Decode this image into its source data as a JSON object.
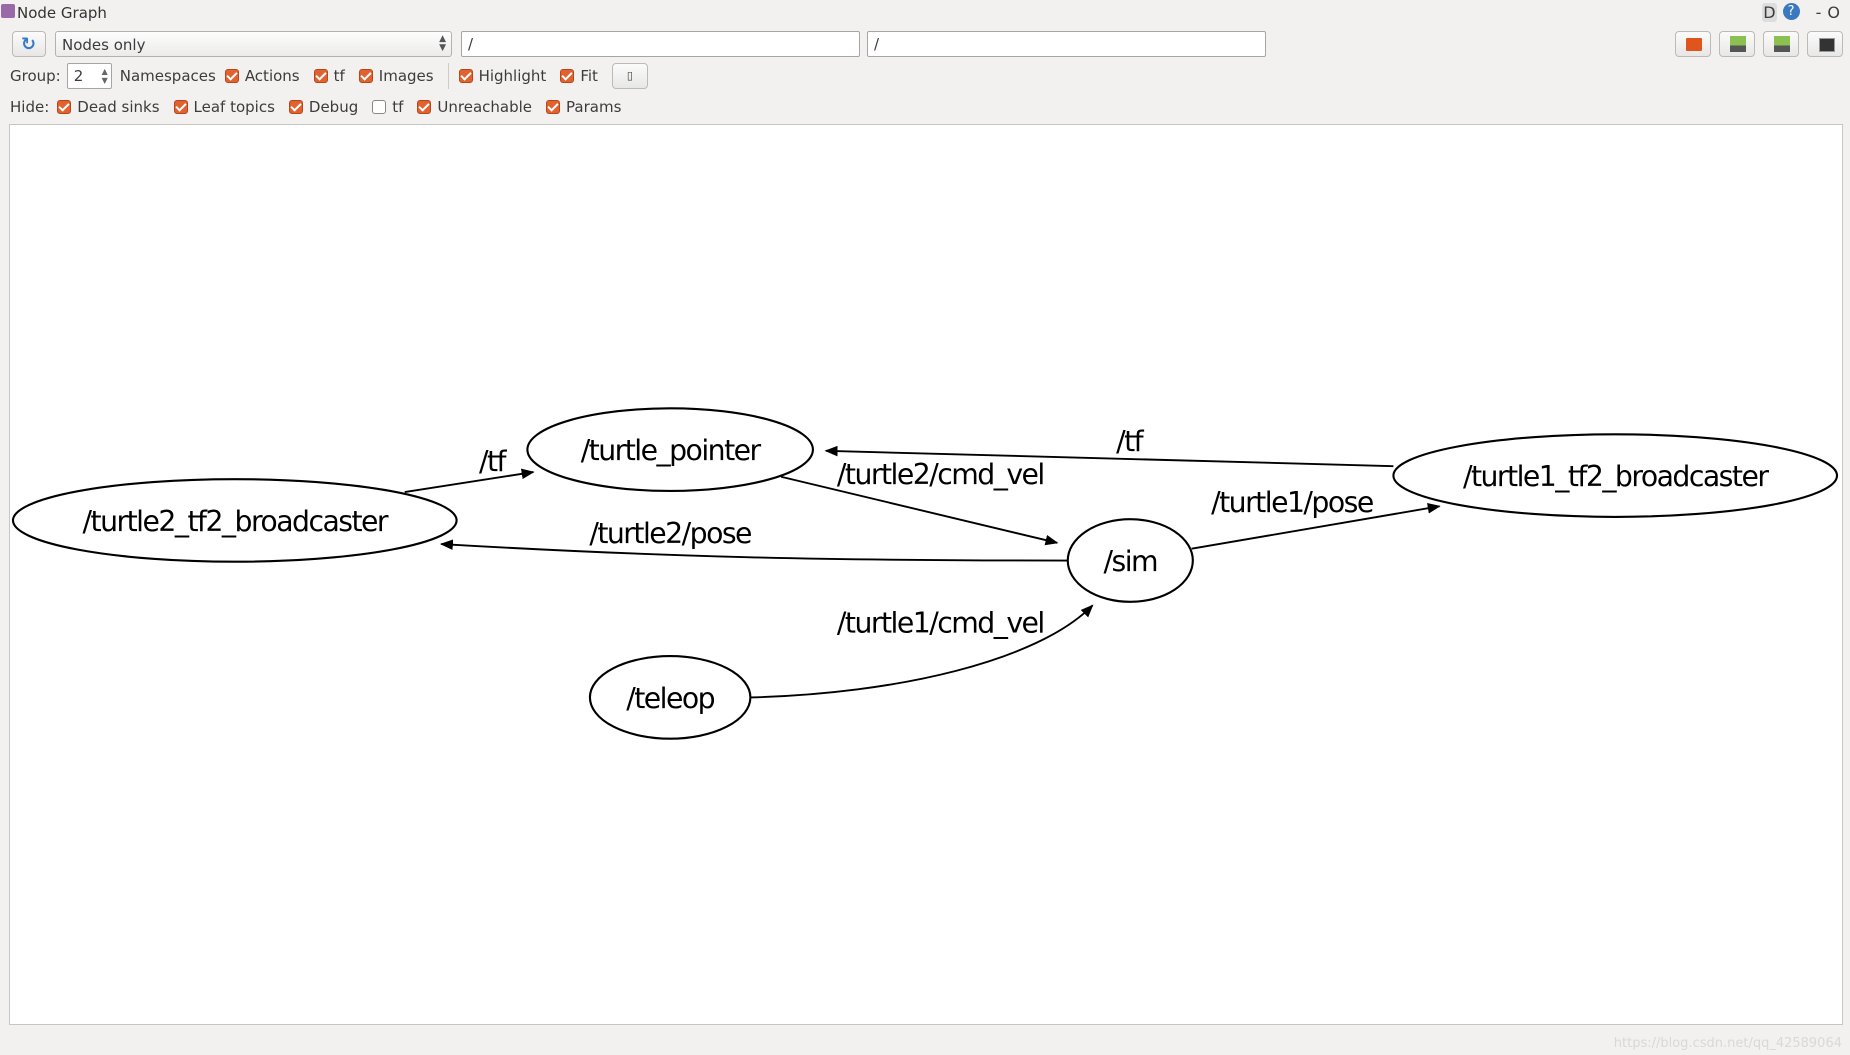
{
  "window": {
    "title": "Node Graph",
    "right_controls": [
      "D",
      "?",
      "-",
      "O"
    ]
  },
  "toolbar": {
    "refresh_icon": "refresh-icon",
    "mode_select": "Nodes only",
    "node_filter": "/",
    "topic_filter": "/",
    "right_buttons": [
      "load-dot-icon",
      "save-dot-icon",
      "save-svg-icon",
      "save-image-icon"
    ]
  },
  "options": {
    "group_label": "Group:",
    "group_value": "2",
    "checkboxes": [
      {
        "label": "Namespaces",
        "checked": true
      },
      {
        "label": "Actions",
        "checked": true
      },
      {
        "label": "tf",
        "checked": true
      },
      {
        "label": "Images",
        "checked": true
      },
      {
        "label": "Highlight",
        "checked": true
      },
      {
        "label": "Fit",
        "checked": true
      }
    ]
  },
  "hide": {
    "label": "Hide:",
    "checkboxes": [
      {
        "label": "Dead sinks",
        "checked": true
      },
      {
        "label": "Leaf topics",
        "checked": true
      },
      {
        "label": "Debug",
        "checked": true
      },
      {
        "label": "tf",
        "checked": false
      },
      {
        "label": "Unreachable",
        "checked": true
      },
      {
        "label": "Params",
        "checked": true
      }
    ]
  },
  "graph": {
    "nodes": [
      "/turtle2_tf2_broadcaster",
      "/turtle_pointer",
      "/sim",
      "/turtle1_tf2_broadcaster",
      "/teleop"
    ],
    "edges": [
      {
        "from": "/turtle2_tf2_broadcaster",
        "to": "/turtle_pointer",
        "label": "/tf"
      },
      {
        "from": "/turtle_pointer",
        "to": "/sim",
        "label": "/turtle2/cmd_vel"
      },
      {
        "from": "/sim",
        "to": "/turtle2_tf2_broadcaster",
        "label": "/turtle2/pose"
      },
      {
        "from": "/turtle1_tf2_broadcaster",
        "to": "/turtle_pointer",
        "label": "/tf"
      },
      {
        "from": "/sim",
        "to": "/turtle1_tf2_broadcaster",
        "label": "/turtle1/pose"
      },
      {
        "from": "/teleop",
        "to": "/sim",
        "label": "/turtle1/cmd_vel"
      }
    ]
  },
  "watermark": "https://blog.csdn.net/qq_42589064"
}
